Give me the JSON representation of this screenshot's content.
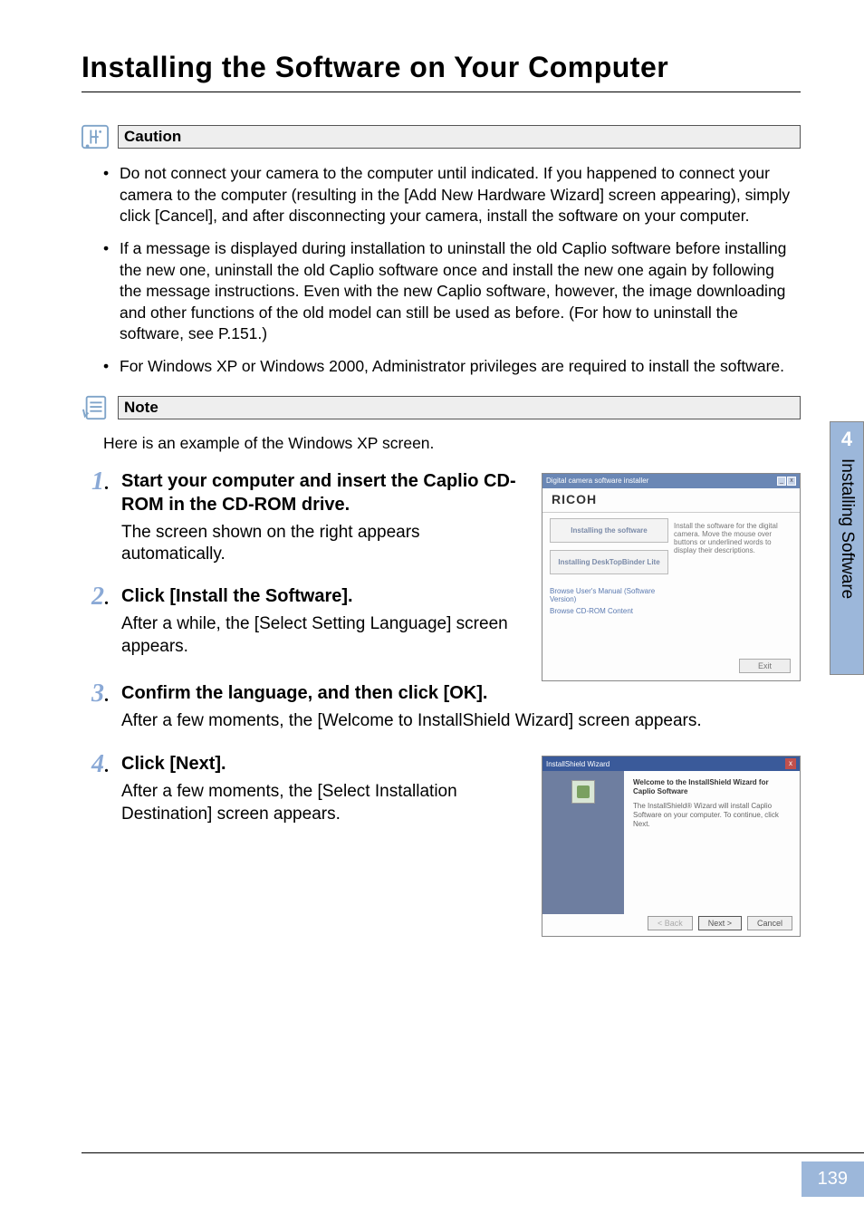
{
  "page": {
    "title": "Installing the Software on Your Computer",
    "number": "139"
  },
  "sidebar": {
    "chapter_number": "4",
    "chapter_title": "Installing Software"
  },
  "caution": {
    "label": "Caution",
    "items": [
      "Do not connect your camera to the computer until indicated. If you happened to connect your camera to the computer (resulting in the [Add New Hardware Wizard] screen appearing), simply click [Cancel], and after disconnecting your camera, install the software on your computer.",
      "If a message is displayed during installation to uninstall the old Caplio software before installing the new one, uninstall the old Caplio software once and install the new one again by following the message instructions. Even with the new Caplio software, however, the image downloading and other functions of the old model can still be used as before. (For how to uninstall the software, see P.151.)",
      "For Windows XP or Windows 2000, Administrator privileges are required to install the software."
    ]
  },
  "note": {
    "label": "Note",
    "text": "Here is an example of the Windows XP screen."
  },
  "steps": [
    {
      "num": "1",
      "title": "Start your computer and insert the Caplio CD-ROM in the CD-ROM drive.",
      "desc": "The screen shown on the right appears automatically."
    },
    {
      "num": "2",
      "title": "Click [Install the Software].",
      "desc": "After a while, the [Select Setting Language] screen appears."
    },
    {
      "num": "3",
      "title": "Confirm the language, and then click [OK].",
      "desc": "After a few moments, the [Welcome to InstallShield Wizard] screen appears."
    },
    {
      "num": "4",
      "title": "Click [Next].",
      "desc": "After a few moments, the [Select Installation Destination] screen appears."
    }
  ],
  "screenshot1": {
    "window_title": "Digital camera software installer",
    "brand": "RICOH",
    "button_install": "Installing the software",
    "button_dx": "Installing DeskTopBinder Lite",
    "link_browse_manual": "Browse User's Manual (Software Version)",
    "link_browse_cd": "Browse CD-ROM Content",
    "right_text": "Install the software for the digital camera. Move the mouse over buttons or underlined words to display their descriptions.",
    "exit_label": "Exit"
  },
  "screenshot2": {
    "window_title": "InstallShield Wizard",
    "heading": "Welcome to the InstallShield Wizard for Caplio Software",
    "body_text": "The InstallShield® Wizard will install Caplio Software on your computer. To continue, click Next.",
    "btn_back": "< Back",
    "btn_next": "Next >",
    "btn_cancel": "Cancel"
  }
}
